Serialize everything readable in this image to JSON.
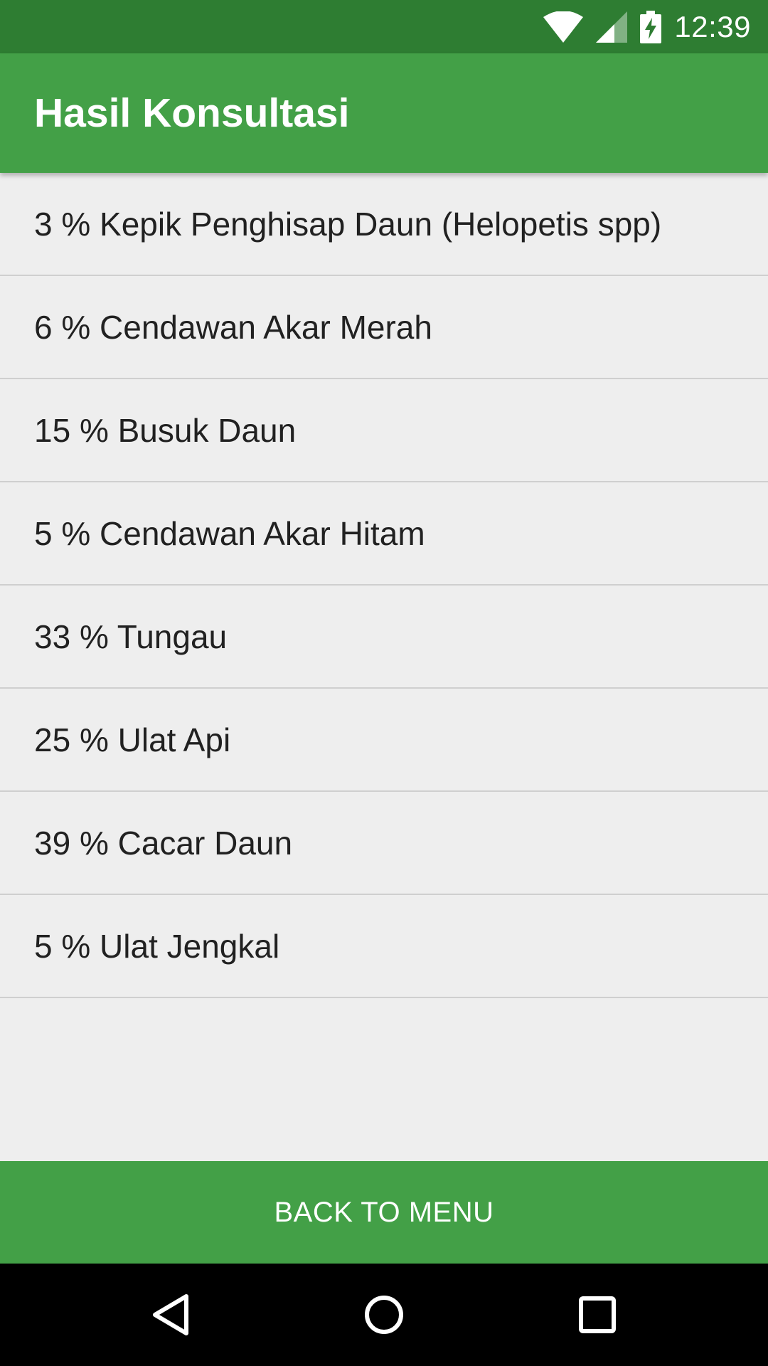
{
  "status_bar": {
    "time": "12:39",
    "icons": [
      "wifi-icon",
      "signal-icon",
      "battery-charging-icon"
    ],
    "background_color": "#2e7d32"
  },
  "app_bar": {
    "title": "Hasil Konsultasi",
    "background_color": "#43a047"
  },
  "results": [
    {
      "label": "3 % Kepik Penghisap Daun (Helopetis spp)"
    },
    {
      "label": "6 % Cendawan Akar Merah"
    },
    {
      "label": "15 % Busuk Daun"
    },
    {
      "label": "5 % Cendawan Akar Hitam"
    },
    {
      "label": "33 % Tungau"
    },
    {
      "label": "25 % Ulat Api"
    },
    {
      "label": "39 % Cacar Daun"
    },
    {
      "label": "5 % Ulat Jengkal"
    }
  ],
  "back_button": {
    "label": "BACK TO MENU",
    "background_color": "#43a047"
  },
  "nav_bar": {
    "icons": [
      "back-icon",
      "home-icon",
      "recents-icon"
    ]
  }
}
